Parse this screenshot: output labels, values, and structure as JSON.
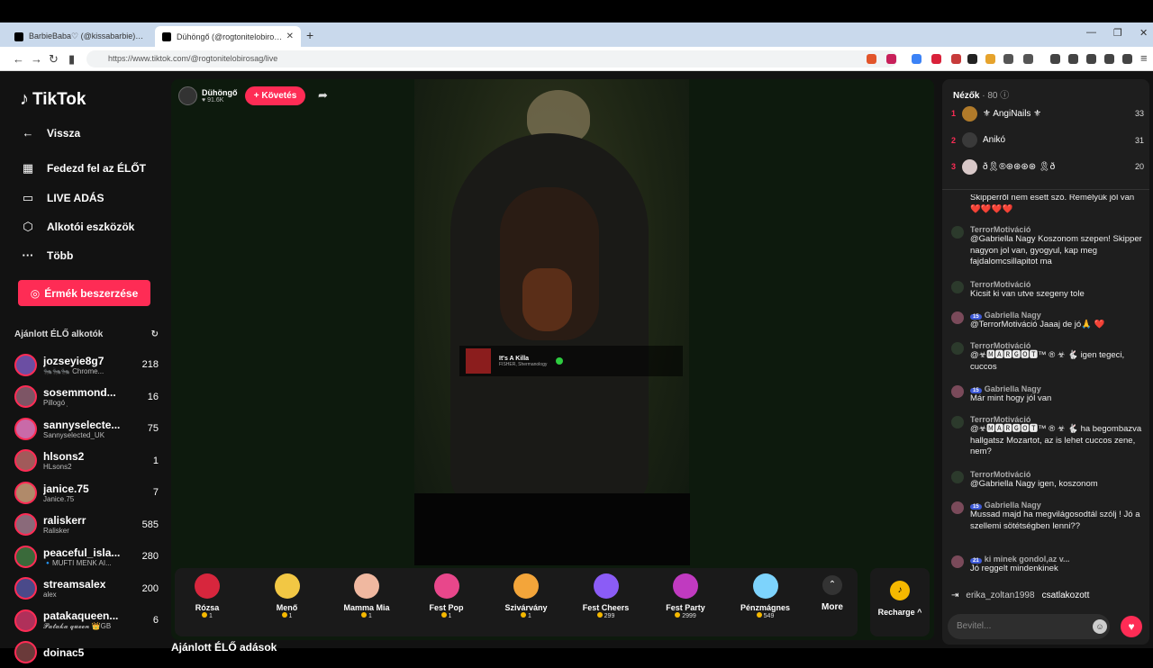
{
  "browser": {
    "tabs": [
      {
        "label": "BarbieBaba♡ (@kissabarbie) ÉLŐ adá"
      },
      {
        "label": "Dühöngő (@rogtonitelobirosag)"
      }
    ],
    "new_tab": "+",
    "url": "https://www.tiktok.com/@rogtonitelobirosag/live"
  },
  "sidebar": {
    "logo": "TikTok",
    "back": "Vissza",
    "items": [
      {
        "label": "Fedezd fel az ÉLŐT"
      },
      {
        "label": "LIVE ADÁS"
      },
      {
        "label": "Alkotói eszközök"
      },
      {
        "label": "Több"
      }
    ],
    "coins_button": "Érmék beszerzése",
    "recommended_title": "Ajánlott ÉLŐ alkotók",
    "creators": [
      {
        "name": "jozseyie8g7",
        "sub": "🐜🐜🐜 Chrome...",
        "count": "218",
        "color": "#6b4ea3"
      },
      {
        "name": "sosemmond...",
        "sub": "Pillogó ᷂",
        "count": "16",
        "color": "#7d5565"
      },
      {
        "name": "sannyselecte...",
        "sub": "Sannyselected_UK",
        "count": "75",
        "color": "#c96aa8"
      },
      {
        "name": "hlsons2",
        "sub": "HLsons2",
        "count": "1",
        "color": "#a15a5a"
      },
      {
        "name": "janice.75",
        "sub": "Janice.75",
        "count": "7",
        "color": "#b08a6a"
      },
      {
        "name": "raliskerr",
        "sub": "Ralisker",
        "count": "585",
        "color": "#8a6a7a"
      },
      {
        "name": "peaceful_isla...",
        "sub": "🔹MUFTI MENK AI...",
        "count": "280",
        "color": "#3a6a3a"
      },
      {
        "name": "streamsalex",
        "sub": "alex",
        "count": "200",
        "color": "#4a4a8a"
      },
      {
        "name": "patakaqueen...",
        "sub": "𝓟𝓪𝓽𝓪𝓴𝓪 𝓺𝓾𝓮𝓮𝓷 👑GB",
        "count": "6",
        "color": "#b0305a"
      },
      {
        "name": "doinac5",
        "sub": "",
        "count": "",
        "color": "#6a3a3a"
      }
    ]
  },
  "live": {
    "host_name": "Dühöngő",
    "host_likes": "91.6K",
    "follow": "+ Követés",
    "song_title": "It's A Killa",
    "song_artist": "FISHER, Shermanology"
  },
  "gifts": [
    {
      "name": "Rózsa",
      "cost": "1",
      "color": "#d7263d"
    },
    {
      "name": "Menő",
      "cost": "1",
      "color": "#f2c744"
    },
    {
      "name": "Mamma Mia",
      "cost": "1",
      "color": "#f0b8a0"
    },
    {
      "name": "Fest Pop",
      "cost": "1",
      "color": "#e8478b"
    },
    {
      "name": "Szivárvány",
      "cost": "1",
      "color": "#f3a53a"
    },
    {
      "name": "Fest Cheers",
      "cost": "299",
      "color": "#8b5cf6"
    },
    {
      "name": "Fest Party",
      "cost": "2999",
      "color": "#c03ac0"
    },
    {
      "name": "Pénzmágnes",
      "cost": "549",
      "color": "#7dd3fc"
    }
  ],
  "more_label": "More",
  "recharge_label": "Recharge ^",
  "below_title": "Ajánlott ÉLŐ adások",
  "chat": {
    "viewers_title": "Nézők",
    "viewers_count": "· 80",
    "top_viewers": [
      {
        "rank": "1",
        "name": "⚜ AngiNails ⚜",
        "score": "33"
      },
      {
        "rank": "2",
        "name": "Anikó",
        "score": "31"
      },
      {
        "rank": "3",
        "name": "ð🎗®⊛⊛⊛⊛ 🎗ð",
        "score": "20"
      }
    ],
    "messages": [
      {
        "user": "",
        "text": "Skipperről nem esett szó. Remélyük jól van ❤️❤️❤️❤️",
        "level": ""
      },
      {
        "user": "TerrorMotiváció",
        "text": "@Gabriella Nagy Koszonom szepen! Skipper nagyon jol van, gyogyul, kap meg fajdalomcsillapitot ma",
        "level": ""
      },
      {
        "user": "TerrorMotiváció",
        "text": "Kicsit ki van utve szegeny tole",
        "level": ""
      },
      {
        "user": "Gabriella Nagy",
        "text": "@TerrorMotiváció Jaaaj de jó🙏 ❤️",
        "level": "15"
      },
      {
        "user": "TerrorMotiváció",
        "text": "@☣🅼🅰🆁🅶🅾🆃™ ® ☣ 🐇 igen tegeci, cuccos",
        "level": ""
      },
      {
        "user": "Gabriella Nagy",
        "text": "Már mint hogy jól van",
        "level": "15"
      },
      {
        "user": "TerrorMotiváció",
        "text": "@☣🅼🅰🆁🅶🅾🆃™ ® ☣ 🐇 ha begombazva hallgatsz Mozartot, az is lehet cuccos zene, nem?",
        "level": ""
      },
      {
        "user": "TerrorMotiváció",
        "text": "@Gabriella Nagy igen, koszonom",
        "level": ""
      },
      {
        "user": "Gabriella Nagy",
        "text": "Mussad majd ha megvilágosodtál szólj ! Jó a szellemi sötétségben lenni??",
        "level": "15"
      },
      {
        "user": "ki minek gondol,az v...",
        "text": "Jó reggelt mindenkinek",
        "level": "21"
      }
    ],
    "joined_user": "erika_zoltan1998",
    "joined_text": "csatlakozott",
    "input_placeholder": "Bevitel..."
  }
}
